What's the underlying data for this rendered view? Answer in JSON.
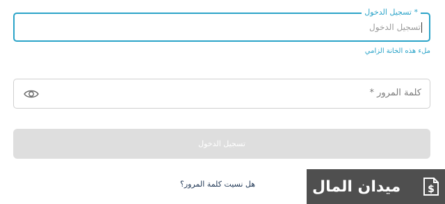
{
  "login": {
    "label": "تسجيل الدخول *",
    "placeholder": "تسجيل الدخول",
    "error": "ملء هذه الخانة الزامي"
  },
  "password": {
    "label": "كلمة المرور *",
    "toggle_icon": "eye-icon"
  },
  "actions": {
    "submit_label": "تسجيل الدخول",
    "forgot_label": "هل نسيت كلمة المرور؟"
  },
  "watermark": {
    "text": "ميدان المال",
    "icon": "dollar-document-icon"
  },
  "colors": {
    "accent": "#2aa3c8",
    "button_disabled": "#dedede",
    "link": "#1d3553",
    "watermark_bg": "#4f4f4f"
  }
}
